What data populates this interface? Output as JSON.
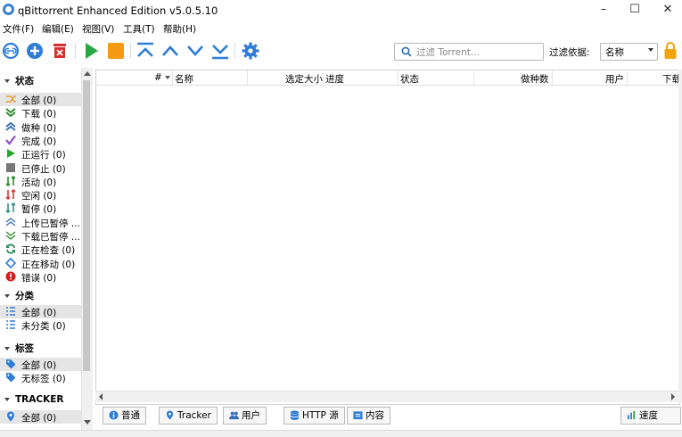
{
  "window": {
    "title": "qBittorrent Enhanced Edition v5.0.5.10"
  },
  "menu": [
    "文件(F)",
    "编辑(E)",
    "视图(V)",
    "工具(T)",
    "帮助(H)"
  ],
  "toolbar": {
    "search_placeholder": "过滤 Torrent...",
    "filter_label": "过滤依据:",
    "filter_value": "名称"
  },
  "sidebar": {
    "status_header": "状态",
    "status_items": [
      {
        "label": "全部 (0)",
        "icon": "all-arrows-icon",
        "color": "#e8a03a"
      },
      {
        "label": "下载 (0)",
        "icon": "download-icon",
        "color": "#2e8b2e"
      },
      {
        "label": "做种 (0)",
        "icon": "seeding-icon",
        "color": "#3a6fb5"
      },
      {
        "label": "完成 (0)",
        "icon": "check-icon",
        "color": "#8a4fc7"
      },
      {
        "label": "正运行 (0)",
        "icon": "play-icon",
        "color": "#2aa52a"
      },
      {
        "label": "已停止 (0)",
        "icon": "stop-icon",
        "color": "#777777"
      },
      {
        "label": "活动 (0)",
        "icon": "active-icon",
        "color": "#2e8b2e"
      },
      {
        "label": "空闲 (0)",
        "icon": "inactive-icon",
        "color": "#d23a3a"
      },
      {
        "label": "暂停 (0)",
        "icon": "stalled-icon",
        "color": "#3a8a8a"
      },
      {
        "label": "上传已暂停 ...",
        "icon": "upload-paused-icon",
        "color": "#3a6fb5"
      },
      {
        "label": "下载已暂停 ...",
        "icon": "download-paused-icon",
        "color": "#2e8b2e"
      },
      {
        "label": "正在检查 (0)",
        "icon": "checking-icon",
        "color": "#2e8b5e"
      },
      {
        "label": "正在移动 (0)",
        "icon": "moving-icon",
        "color": "#2f7dd6"
      },
      {
        "label": "错误 (0)",
        "icon": "error-icon",
        "color": "#d21f1f"
      }
    ],
    "category_header": "分类",
    "category_items": [
      {
        "label": "全部 (0)",
        "icon": "list-icon",
        "color": "#2f7dd6"
      },
      {
        "label": "未分类 (0)",
        "icon": "list-icon",
        "color": "#2f7dd6"
      }
    ],
    "tag_header": "标签",
    "tag_items": [
      {
        "label": "全部 (0)",
        "icon": "tag-icon",
        "color": "#2f7dd6"
      },
      {
        "label": "无标签 (0)",
        "icon": "tag-icon",
        "color": "#2f7dd6"
      }
    ],
    "tracker_header": "TRACKER",
    "tracker_items": [
      {
        "label": "全部 (0)",
        "icon": "pin-icon",
        "color": "#2f7dd6"
      }
    ]
  },
  "table": {
    "columns": [
      "#",
      "名称",
      "选定大小",
      "进度",
      "状态",
      "做种数",
      "用户",
      "下载"
    ]
  },
  "bottom_tabs": [
    {
      "label": "普通",
      "icon": "info-icon"
    },
    {
      "label": "Tracker",
      "icon": "pin-icon"
    },
    {
      "label": "用户",
      "icon": "users-icon"
    },
    {
      "label": "HTTP 源",
      "icon": "database-icon"
    },
    {
      "label": "内容",
      "icon": "folder-icon"
    }
  ],
  "speed_button": {
    "label": "速度",
    "icon": "bar-chart-icon"
  }
}
